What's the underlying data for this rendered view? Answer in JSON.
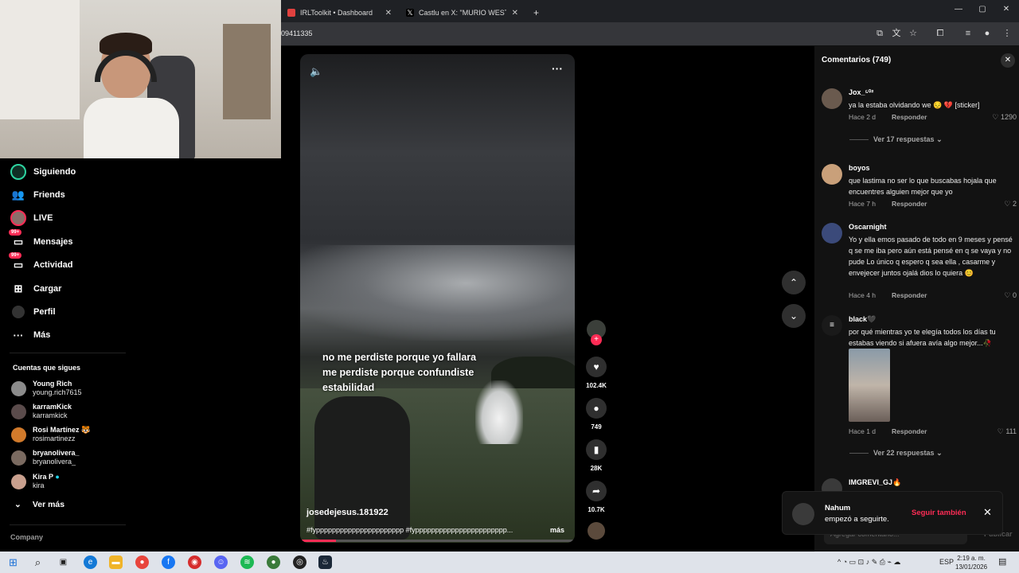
{
  "browser": {
    "tabs": [
      {
        "label": "IRLToolkit • Dashboard",
        "fav_color": "#e0413f"
      },
      {
        "label": "Castlu en X: \"MURIO WESTCOL",
        "fav_color": "#000000"
      }
    ],
    "new_tab": "+",
    "url_fragment": "09411335",
    "window_controls": [
      "—",
      "▢",
      "✕"
    ]
  },
  "sidebar": {
    "nav": [
      {
        "label": "Siguiendo",
        "icon": "following-icon"
      },
      {
        "label": "Friends",
        "icon": "friends-icon"
      },
      {
        "label": "LIVE",
        "icon": "live-icon"
      },
      {
        "label": "Mensajes",
        "icon": "messages-icon",
        "badge": "99+"
      },
      {
        "label": "Actividad",
        "icon": "activity-icon",
        "badge": "99+"
      },
      {
        "label": "Cargar",
        "icon": "upload-icon"
      },
      {
        "label": "Perfil",
        "icon": "profile-icon"
      },
      {
        "label": "Más",
        "icon": "more-icon"
      }
    ],
    "following_title": "Cuentas que sigues",
    "following": [
      {
        "name": "Young Rich",
        "handle": "young.rich7615",
        "color": "#8c8c8c"
      },
      {
        "name": "karramKick",
        "handle": "karramkick",
        "color": "#5a4b4b"
      },
      {
        "name": "Rosi Martínez 🐯",
        "handle": "rosimartinezz",
        "color": "#d17a2b"
      },
      {
        "name": "bryanolivera_",
        "handle": "bryanolivera_",
        "color": "#7a6a60"
      },
      {
        "name": "Kira P",
        "handle": "kira",
        "color": "#c9a08e"
      }
    ],
    "see_more": "Ver más",
    "footer": "Company"
  },
  "video": {
    "caption": "no me perdiste porque yo fallara me perdiste porque confundiste estabilidad",
    "username": "josedejesus.181922",
    "description": "#fypppppppppppppppppppppp #fyppppppppppppppppppppppp...",
    "more": "más",
    "progress": 0.13
  },
  "actions": {
    "likes": "102.4K",
    "comments": "749",
    "saves": "28K",
    "shares": "10.7K"
  },
  "comments": {
    "title": "Comentarios",
    "count": "(749)",
    "reply_label": "Responder",
    "items": [
      {
        "user": "Jox_⁵⁰²",
        "text": "ya la estaba olvidando we 😔 💔 [sticker]",
        "time": "Hace 2 d",
        "likes": "1290",
        "replies": "Ver 17 respuestas",
        "avatar": "#6a5a4e"
      },
      {
        "user": "boyos",
        "text": "que lastima no ser lo que buscabas hojala que encuentres alguien mejor que yo",
        "time": "Hace 7 h",
        "likes": "2",
        "avatar": "#c9a07a"
      },
      {
        "user": "Oscarnight",
        "text": "Yo y ella emos pasado de todo en 9 meses y pensé q se me iba pero aún está pensé en q se vaya y no pude Lo único q espero q sea ella , casarme y envejecer juntos ojalá dios lo quiera 😊",
        "time": "Hace 4 h",
        "likes": "0",
        "avatar": "#3b4a7a"
      },
      {
        "user": "black🖤",
        "text": "por qué mientras yo te elegía todos los días tu estabas viendo si afuera avía algo mejor...🥀",
        "time": "Hace 1 d",
        "likes": "111",
        "replies": "Ver 22 respuestas",
        "avatar": "#1a1a1a"
      },
      {
        "user": "IMGREVI_GJ🔥",
        "avatar": "#3a3a3a"
      }
    ],
    "input_placeholder": "Agregar comentario...",
    "publish": "Publicar"
  },
  "toast": {
    "name": "Nahum",
    "message": "empezó a seguirte.",
    "button": "Seguir también"
  },
  "taskbar": {
    "lang": "ESP",
    "time": "2:19 a. m.",
    "date": "13/01/2026"
  }
}
